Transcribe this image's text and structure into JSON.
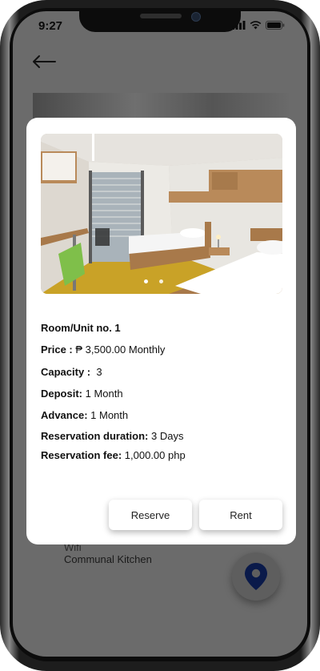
{
  "status_bar": {
    "time": "9:27"
  },
  "background": {
    "amenity_partial": "Wifi",
    "amenity": "Communal Kitchen"
  },
  "modal": {
    "room_title": "Room/Unit no. 1",
    "price": {
      "label": "Price :",
      "value": "₱ 3,500.00 Monthly"
    },
    "capacity": {
      "label": "Capacity :",
      "value": "3"
    },
    "deposit": {
      "label": "Deposit:",
      "value": "1 Month"
    },
    "advance": {
      "label": "Advance:",
      "value": "1 Month"
    },
    "reservation_duration": {
      "label": "Reservation duration:",
      "value": "3 Days"
    },
    "reservation_fee": {
      "label": "Reservation fee:",
      "value": "1,000.00 php"
    },
    "carousel": {
      "total": 2,
      "active": 1
    },
    "buttons": {
      "reserve": "Reserve",
      "rent": "Rent"
    }
  },
  "colors": {
    "overlay": "#6b6b6b",
    "map_pin": "#0a1a4a",
    "card": "#ffffff"
  },
  "icons": [
    "back-arrow-icon",
    "signal-icon",
    "wifi-icon",
    "battery-icon",
    "map-pin-icon"
  ]
}
